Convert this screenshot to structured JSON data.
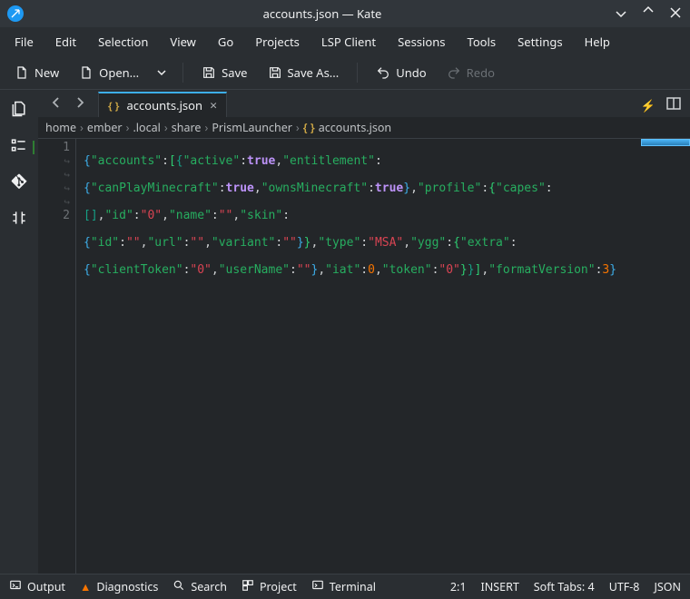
{
  "window": {
    "title": "accounts.json — Kate"
  },
  "menubar": [
    "File",
    "Edit",
    "Selection",
    "View",
    "Go",
    "Projects",
    "LSP Client",
    "Sessions",
    "Tools",
    "Settings",
    "Help"
  ],
  "toolbar": {
    "new": "New",
    "open": "Open...",
    "save": "Save",
    "saveas": "Save As...",
    "undo": "Undo",
    "redo": "Redo"
  },
  "tab": {
    "filename": "accounts.json"
  },
  "breadcrumb": [
    "home",
    "ember",
    ".local",
    "share",
    "PrismLauncher",
    "accounts.json"
  ],
  "gutter": {
    "line1": "1",
    "line2": "2"
  },
  "code": {
    "l1": "{\"accounts\":[{\"active\":true,\"entitlement\":",
    "l2": "{\"canPlayMinecraft\":true,\"ownsMinecraft\":true},\"profile\":{\"capes\":",
    "l3": "[],\"id\":\"0\",\"name\":\"\",\"skin\":",
    "l4": "{\"id\":\"\",\"url\":\"\",\"variant\":\"\"}},\"type\":\"MSA\",\"ygg\":{\"extra\":",
    "l5": "{\"clientToken\":\"0\",\"userName\":\"\"},\"iat\":0,\"token\":\"0\"}}],\"formatVersion\":3}"
  },
  "statusbar": {
    "output": "Output",
    "diagnostics": "Diagnostics",
    "search": "Search",
    "project": "Project",
    "terminal": "Terminal",
    "cursor": "2:1",
    "mode": "INSERT",
    "tabs": "Soft Tabs: 4",
    "encoding": "UTF-8",
    "lang": "JSON"
  }
}
